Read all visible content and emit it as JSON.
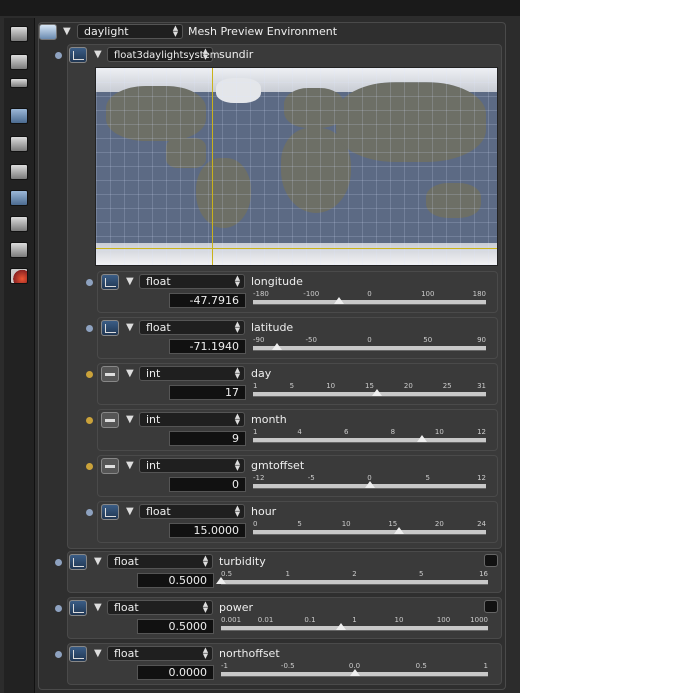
{
  "header": {
    "env_select": "daylight",
    "env_title": "Mesh Preview Environment"
  },
  "sundir": {
    "type_select": "float3daylightsystem",
    "label": "sundir"
  },
  "params": [
    {
      "type": "float",
      "label": "longitude",
      "value": "-47.7916",
      "ticks": [
        "-180",
        "-100",
        "0",
        "100",
        "180"
      ],
      "fraction": 0.367,
      "dot": "blue",
      "icon": "curve"
    },
    {
      "type": "float",
      "label": "latitude",
      "value": "-71.1940",
      "ticks": [
        "-90",
        "-50",
        "0",
        "50",
        "90"
      ],
      "fraction": 0.104,
      "dot": "blue",
      "icon": "curve"
    },
    {
      "type": "int",
      "label": "day",
      "value": "17",
      "ticks": [
        "1",
        "5",
        "10",
        "15",
        "20",
        "25",
        "31"
      ],
      "fraction": 0.533,
      "dot": "yellow",
      "icon": "bar"
    },
    {
      "type": "int",
      "label": "month",
      "value": "9",
      "ticks": [
        "1",
        "4",
        "6",
        "8",
        "10",
        "12"
      ],
      "fraction": 0.727,
      "dot": "yellow",
      "icon": "bar"
    },
    {
      "type": "int",
      "label": "gmtoffset",
      "value": "0",
      "ticks": [
        "-12",
        "-5",
        "0",
        "5",
        "12"
      ],
      "fraction": 0.5,
      "dot": "yellow",
      "icon": "bar"
    },
    {
      "type": "float",
      "label": "hour",
      "value": "15.0000",
      "ticks": [
        "0",
        "5",
        "10",
        "15",
        "20",
        "24"
      ],
      "fraction": 0.625,
      "dot": "blue",
      "icon": "curve"
    }
  ],
  "outer_params": [
    {
      "type": "float",
      "label": "turbidity",
      "value": "0.5000",
      "ticks": [
        "0.5",
        "1",
        "2",
        "5",
        "16"
      ],
      "fraction": 0.0
    },
    {
      "type": "float",
      "label": "power",
      "value": "0.5000",
      "ticks": [
        "0.001",
        "0.01",
        "0.1",
        "1",
        "10",
        "100",
        "1000"
      ],
      "fraction": 0.45
    },
    {
      "type": "float",
      "label": "northoffset",
      "value": "0.0000",
      "ticks": [
        "-1",
        "-0.5",
        "0.0",
        "0.5",
        "1"
      ],
      "fraction": 0.5
    }
  ],
  "toolbar_icons": [
    "camera-icon",
    "layers-icon",
    "outliner-icon",
    "image-icon",
    "render-camera-icon",
    "panel-icon",
    "cylinder-icon",
    "picture-icon",
    "network-icon",
    "material-icon"
  ],
  "colors": {
    "dot_blue": "#8ea2c0",
    "dot_yellow": "#caa23a",
    "panel_bg": "#3a3a3a"
  }
}
